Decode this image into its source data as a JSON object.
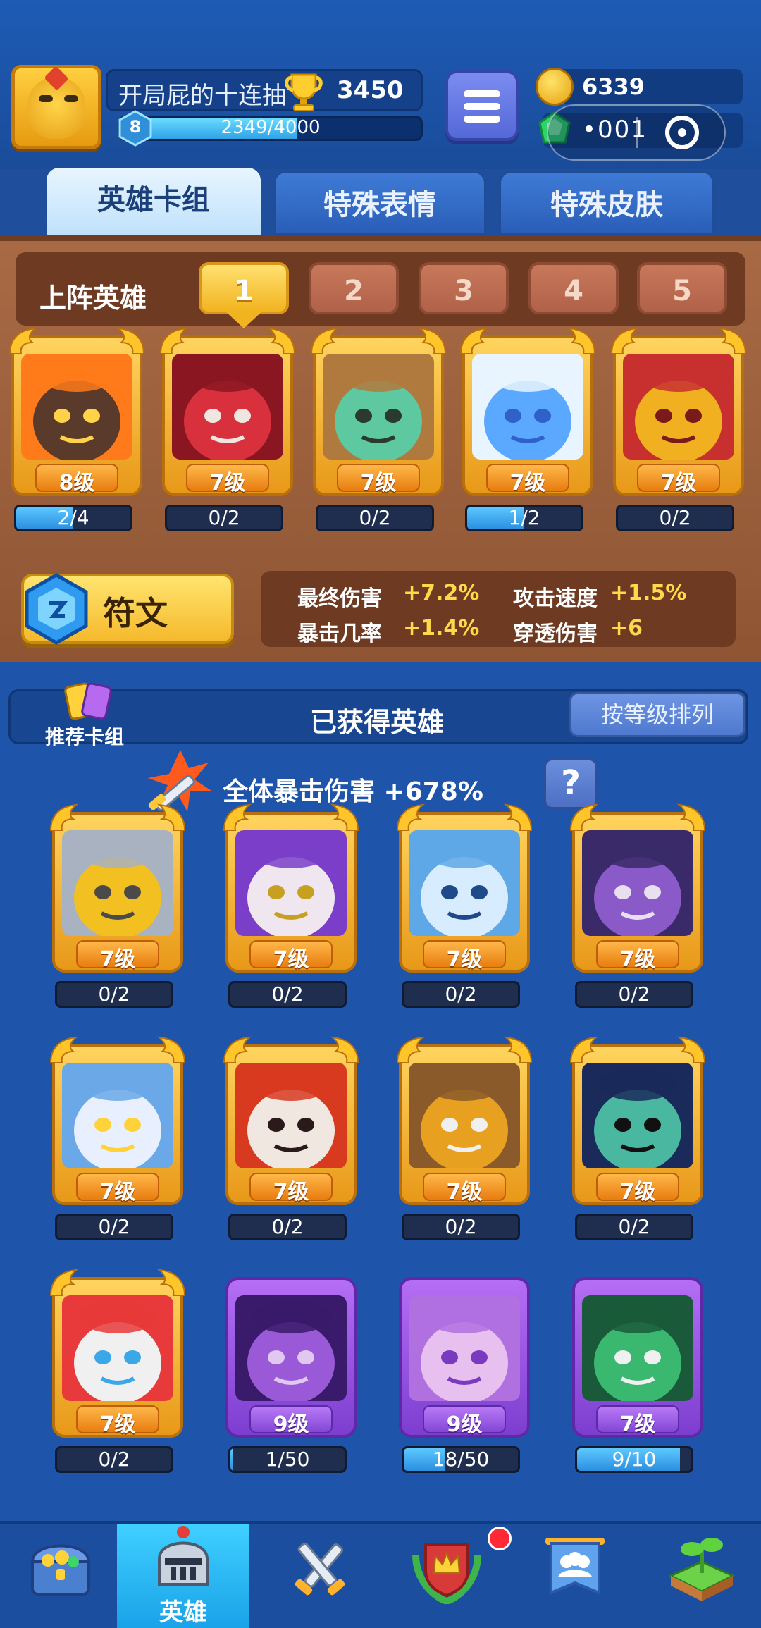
{
  "player": {
    "name": "开局屁的十连抽",
    "trophies": "3450",
    "level": "8",
    "xp_text": "2349/4000",
    "xp_fraction": 0.587
  },
  "currency": {
    "gold": "6339",
    "gems_masked": "•001"
  },
  "tabs": [
    {
      "label": "英雄卡组",
      "active": true
    },
    {
      "label": "特殊表情",
      "active": false
    },
    {
      "label": "特殊皮肤",
      "active": false
    }
  ],
  "deck": {
    "label": "上阵英雄",
    "slots": [
      "1",
      "2",
      "3",
      "4",
      "5"
    ],
    "active_slot": 0,
    "heroes": [
      {
        "level": "8级",
        "progress": "2/4",
        "fraction": 0.5,
        "art": "lava"
      },
      {
        "level": "7级",
        "progress": "0/2",
        "fraction": 0.0,
        "art": "red"
      },
      {
        "level": "7级",
        "progress": "0/2",
        "fraction": 0.0,
        "art": "cowboy"
      },
      {
        "level": "7级",
        "progress": "1/2",
        "fraction": 0.5,
        "art": "frost"
      },
      {
        "level": "7级",
        "progress": "0/2",
        "fraction": 0.0,
        "art": "spartan"
      }
    ]
  },
  "rune": {
    "label": "符文"
  },
  "stats": [
    {
      "label": "最终伤害",
      "value": "+7.2%"
    },
    {
      "label": "攻击速度",
      "value": "+1.5%"
    },
    {
      "label": "暴击几率",
      "value": "+1.4%"
    },
    {
      "label": "穿透伤害",
      "value": "+6"
    }
  ],
  "owned": {
    "recommend_label": "推荐卡组",
    "title": "已获得英雄",
    "sort_label": "按等级排列",
    "crit_text": "全体暴击伤害 +678%",
    "help_label": "?",
    "heroes": [
      {
        "level": "7级",
        "progress": "0/2",
        "fraction": 0.0,
        "art": "knight",
        "rarity": "gold"
      },
      {
        "level": "7级",
        "progress": "0/2",
        "fraction": 0.0,
        "art": "skull",
        "rarity": "gold"
      },
      {
        "level": "7级",
        "progress": "0/2",
        "fraction": 0.0,
        "art": "yeti",
        "rarity": "gold"
      },
      {
        "level": "7级",
        "progress": "0/2",
        "fraction": 0.0,
        "art": "octopus",
        "rarity": "gold"
      },
      {
        "level": "7级",
        "progress": "0/2",
        "fraction": 0.0,
        "art": "zeus",
        "rarity": "gold"
      },
      {
        "level": "7级",
        "progress": "0/2",
        "fraction": 0.0,
        "art": "hooded",
        "rarity": "gold"
      },
      {
        "level": "7级",
        "progress": "0/2",
        "fraction": 0.0,
        "art": "musketeer",
        "rarity": "gold"
      },
      {
        "level": "7级",
        "progress": "0/2",
        "fraction": 0.0,
        "art": "police",
        "rarity": "gold"
      },
      {
        "level": "7级",
        "progress": "0/2",
        "fraction": 0.0,
        "art": "clown",
        "rarity": "gold"
      },
      {
        "level": "9级",
        "progress": "1/50",
        "fraction": 0.02,
        "art": "tophat",
        "rarity": "purple"
      },
      {
        "level": "9级",
        "progress": "18/50",
        "fraction": 0.36,
        "art": "mage",
        "rarity": "purple"
      },
      {
        "level": "7级",
        "progress": "9/10",
        "fraction": 0.9,
        "art": "mask",
        "rarity": "purple"
      }
    ]
  },
  "nav": [
    {
      "icon": "treasure-chest-icon",
      "label": "",
      "active": false
    },
    {
      "icon": "knight-helmet-icon",
      "label": "英雄",
      "active": true
    },
    {
      "icon": "crossed-swords-icon",
      "label": "",
      "active": false
    },
    {
      "icon": "crown-shield-icon",
      "label": "",
      "active": false,
      "badge": true
    },
    {
      "icon": "guild-banner-icon",
      "label": "",
      "active": false
    },
    {
      "icon": "sprout-island-icon",
      "label": "",
      "active": false
    }
  ],
  "colors": {
    "background": "#1f4f9c",
    "gold": "#f2b320",
    "purple": "#8246d6",
    "deck_panel": "#a86a45",
    "active_nav": "#1aa2e8"
  }
}
